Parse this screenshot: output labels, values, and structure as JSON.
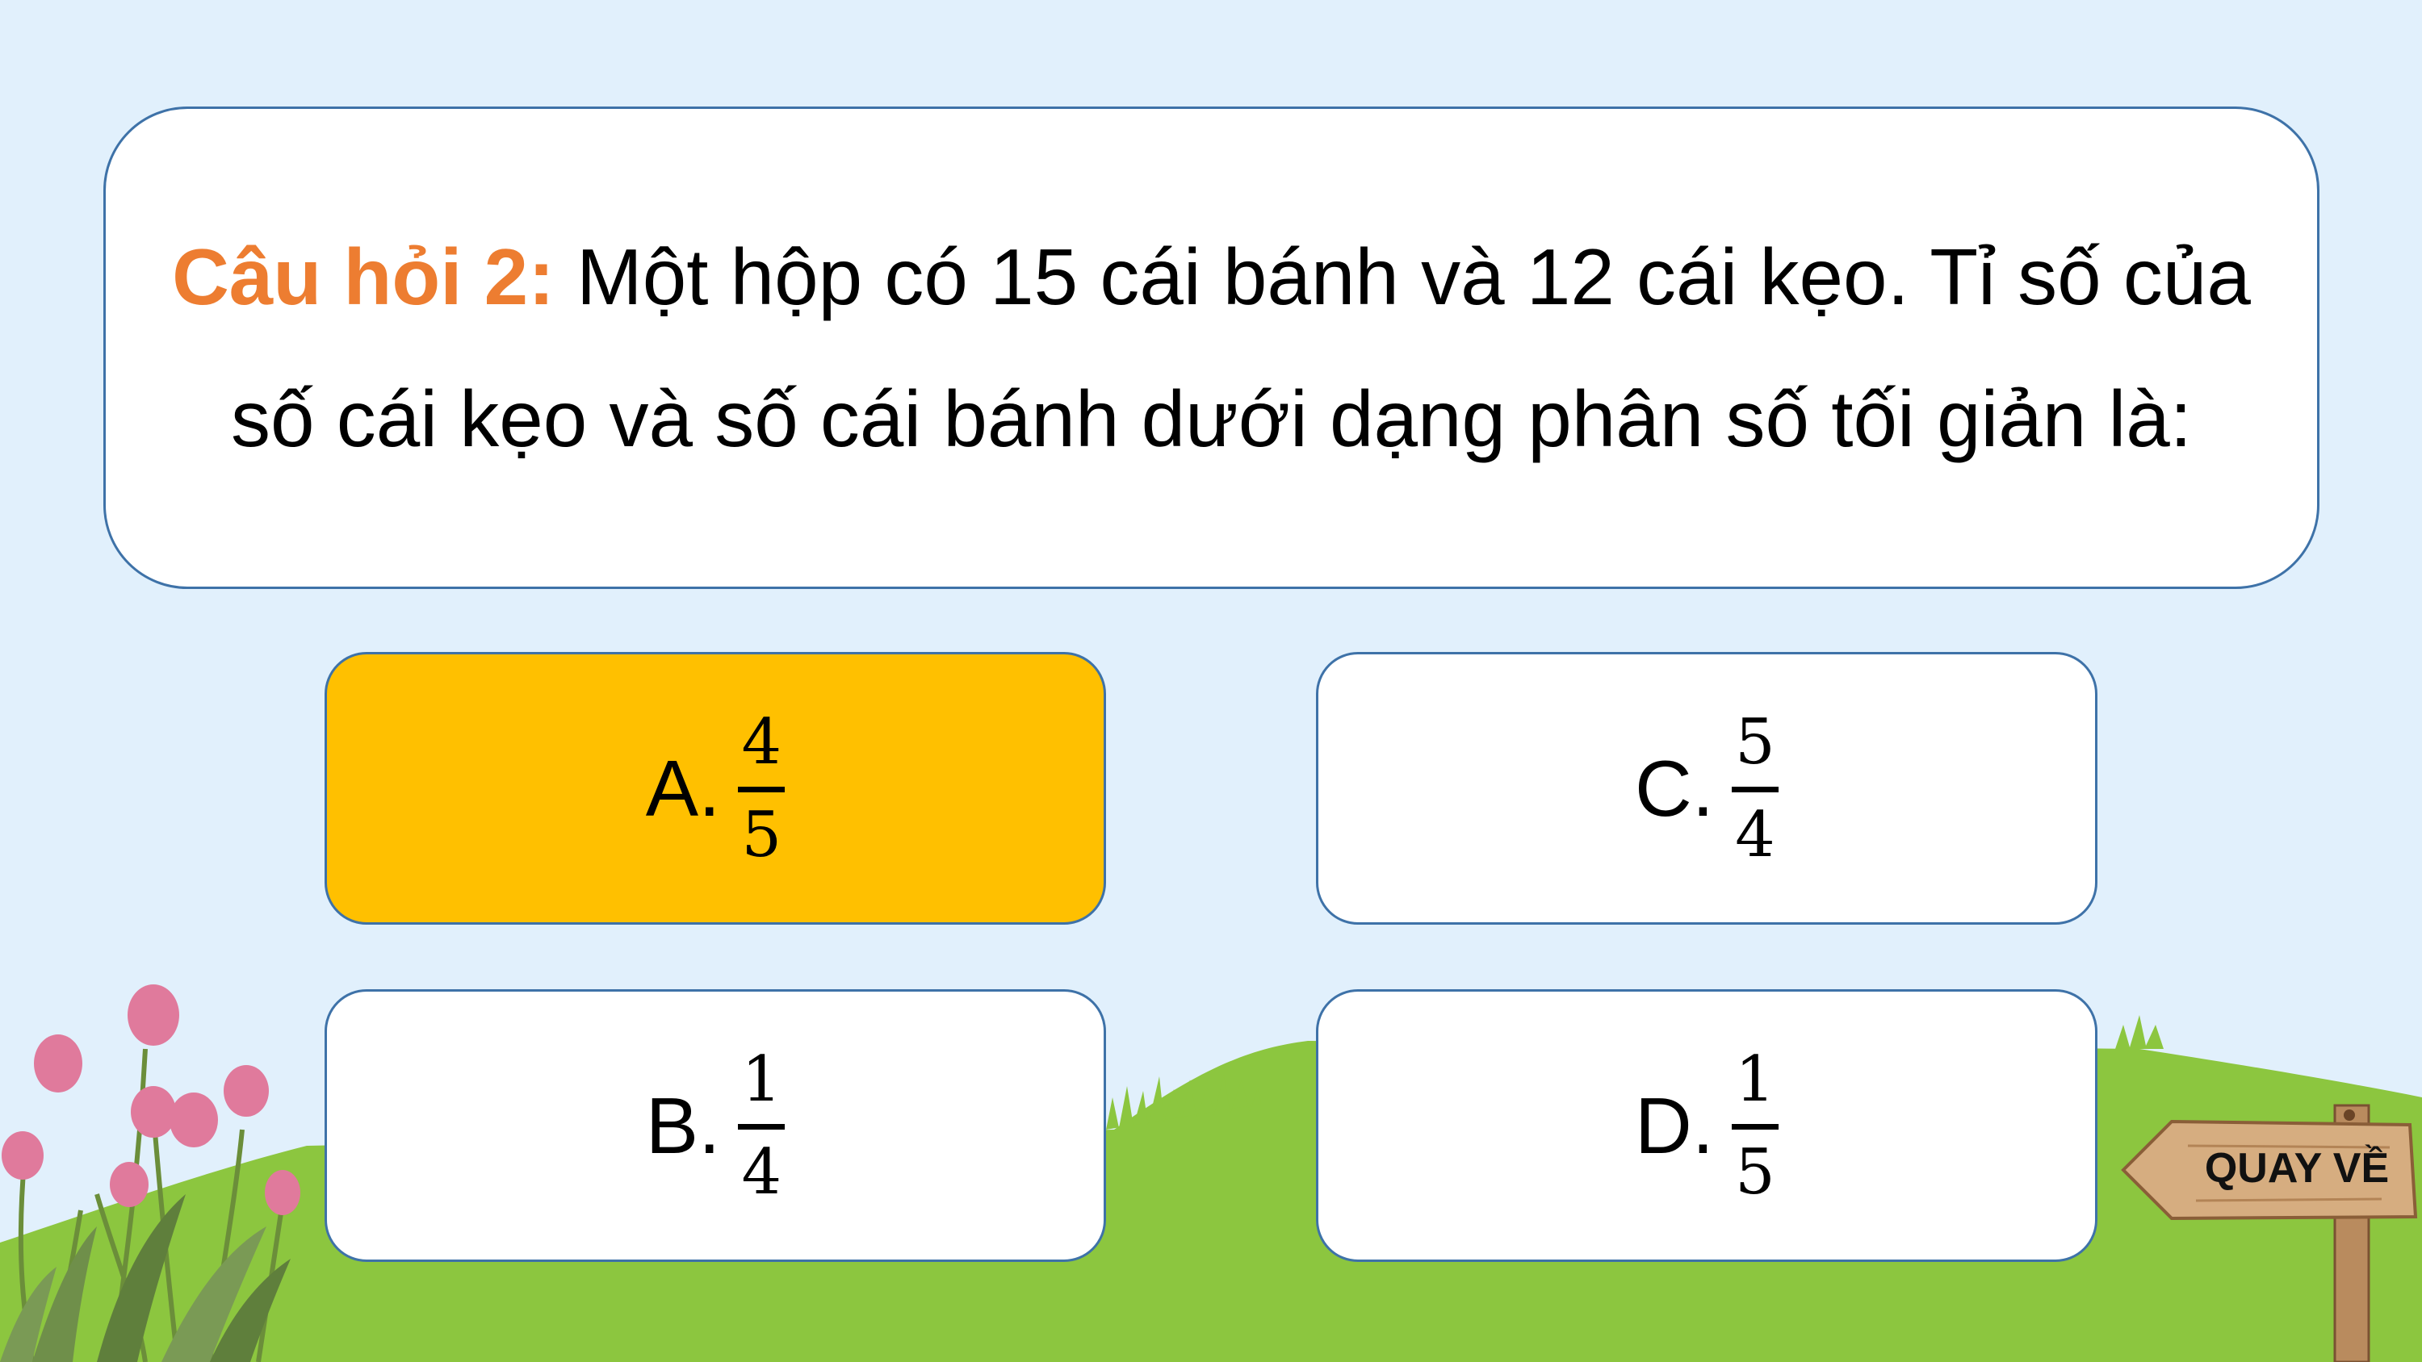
{
  "question": {
    "label": "Câu hỏi 2:",
    "text": " Một hộp có 15 cái bánh và 12 cái kẹo. Tỉ số của số cái kẹo và số cái bánh dưới dạng phân số tối giản là:"
  },
  "answers": [
    {
      "letter": "A.",
      "numerator": "4",
      "denominator": "5",
      "selected": true
    },
    {
      "letter": "C.",
      "numerator": "5",
      "denominator": "4",
      "selected": false
    },
    {
      "letter": "B.",
      "numerator": "1",
      "denominator": "4",
      "selected": false
    },
    {
      "letter": "D.",
      "numerator": "1",
      "denominator": "5",
      "selected": false
    }
  ],
  "back_button": {
    "label": "QUAY VỀ"
  },
  "colors": {
    "background": "#e1f0fc",
    "question_label": "#ed7d31",
    "selected_answer": "#ffc000",
    "border": "#3e72a8",
    "grass": "#8cc63f"
  }
}
